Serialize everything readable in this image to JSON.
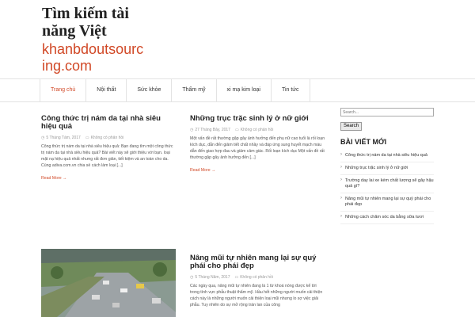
{
  "site": {
    "title": "Tìm kiếm tài năng Việt",
    "domain": "khanbdoutsourcing.com"
  },
  "nav": [
    "Trang chủ",
    "Nội thất",
    "Sức khỏe",
    "Thẩm mỹ",
    "xi mạ kim loại",
    "Tin tức"
  ],
  "posts": [
    {
      "title": "Công thức trị nám da tại nhà siêu hiệu quả",
      "date": "5 Tháng Tám, 2017",
      "comments": "Không có phản hồi",
      "excerpt": "Công thức trị nám da tại nhà siêu hiệu quả: Bạn đang tìm một công thức trị nám da tại nhà siêu hiệu quả? Bài viết này sẽ giới thiệu với bạn. loại mặt nạ hiệu quả nhất nhưng rất đơn giản, tiết kiệm và an toàn cho da. Cùng adiva.com.vn chia sẻ cách làm loại [...]",
      "more": "Read More →"
    },
    {
      "title": "Những trục trặc sinh lý ở nữ giới",
      "date": "27 Tháng Bảy, 2017",
      "comments": "Không có phản hồi",
      "excerpt": "Một vấn đề rất thường gặp gây ảnh hưởng đến phụ nữ cao tuổi là rối loạn kích dục, dẫn đến giảm tiết chất nhầy và đáp ứng sung huyết mạch máu dẫn đến giao hợp đau và giảm cảm giác. Rối loạn kích dục Một vấn đề rất thường gặp gây ảnh hưởng đến [...]",
      "more": "Read More →"
    },
    {
      "title": "Nâng mũi tự nhiên mang lại sự quý phái cho phái đẹp",
      "date": "5 Tháng Năm, 2017",
      "comments": "Không có phản hồi",
      "excerpt": "Các ngày qua, nâng mũi tự nhiên đang là 1 từ khoá nóng được kể tới trong tình vực phẫu thuật thẩm mỹ. Hầu hết những người muốn cải thiện cách này là những người muốn cải thiện loại mũi nhưng lo sợ việc giải phẫu. Tuy nhiên do sự mở rộng tràn lan của công"
    }
  ],
  "sidebar": {
    "search_placeholder": "Search...",
    "search_button": "Search",
    "widget_title": "BÀI VIẾT MỚI",
    "recent": [
      "Công thức trị nám da tại nhà siêu hiệu quả",
      "Những trục trặc sinh lý ở nữ giới",
      "Trường day lai xe kém chất lượng sẽ gây hậu quả gì?",
      "Nâng mũi tự nhiên mang lại sự quý phái cho phái đẹp",
      "Những cách chăm sóc da bằng sữa tươi"
    ]
  },
  "colors": {
    "accent": "#d14826",
    "text": "#333333"
  }
}
